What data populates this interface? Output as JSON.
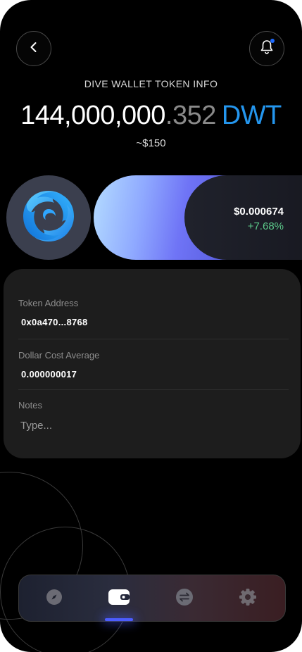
{
  "header": {
    "title": "DIVE WALLET TOKEN INFO",
    "balance_integer": "144,000,000",
    "balance_decimal": ".352",
    "symbol": "DWT",
    "usd_value": "~$150"
  },
  "price": {
    "value": "$0.000674",
    "change": "+7.68%"
  },
  "details": {
    "token_address_label": "Token Address",
    "token_address": "0x0a470...8768",
    "dca_label": "Dollar Cost Average",
    "dca_value": "0.000000017",
    "notes_label": "Notes",
    "notes_placeholder": "Type..."
  },
  "colors": {
    "accent": "#2496ee",
    "positive": "#5cc98a",
    "indicator": "#4c5dff",
    "notification": "#1f6bff"
  },
  "icons": {
    "back": "chevron-left-icon",
    "notifications": "bell-icon",
    "token_logo": "swirl-logo-icon",
    "nav": [
      "compass-icon",
      "wallet-icon",
      "swap-icon",
      "settings-icon"
    ]
  },
  "nav": {
    "active_index": 1
  }
}
